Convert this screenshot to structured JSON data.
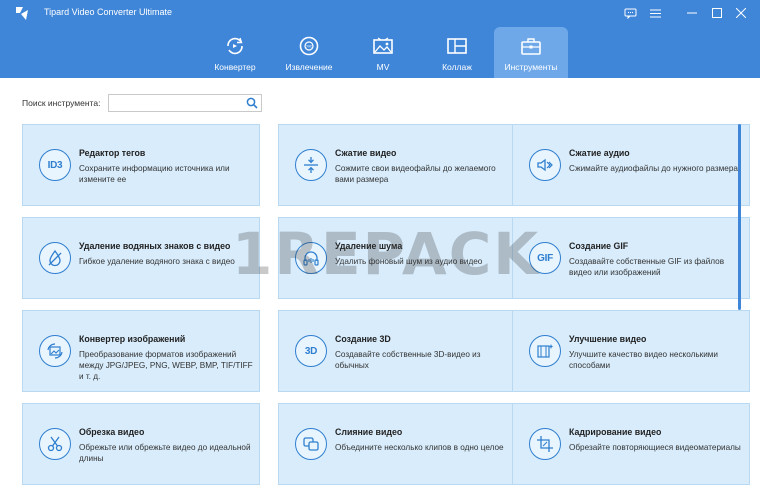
{
  "app": {
    "title": "Tipard Video Converter Ultimate"
  },
  "tabs": [
    {
      "label": "Конвертер",
      "icon": "converter-icon"
    },
    {
      "label": "Извлечение",
      "icon": "dvd-rip-icon"
    },
    {
      "label": "MV",
      "icon": "mv-image-icon"
    },
    {
      "label": "Коллаж",
      "icon": "collage-icon"
    },
    {
      "label": "Инструменты",
      "icon": "toolbox-icon",
      "active": true
    }
  ],
  "search": {
    "label": "Поиск инструмента:",
    "value": "",
    "placeholder": ""
  },
  "tools": [
    {
      "title": "Редактор тегов",
      "desc": "Сохраните информацию источника или измените ее",
      "icon_text": "ID3"
    },
    {
      "title": "Сжатие видео",
      "desc": "Сожмите свои видеофайлы до желаемого вами размера",
      "icon_text": ""
    },
    {
      "title": "Сжатие аудио",
      "desc": "Сжимайте аудиофайлы до нужного размера.",
      "icon_text": ""
    },
    {
      "title": "Удаление водяных знаков с видео",
      "desc": "Гибкое удаление водяного знака с видео",
      "icon_text": ""
    },
    {
      "title": "Удаление шума",
      "desc": "Удалить фоновый шум из аудио видео",
      "icon_text": ""
    },
    {
      "title": "Создание GIF",
      "desc": "Создавайте собственные GIF из файлов видео или изображений",
      "icon_text": "GIF"
    },
    {
      "title": "Конвертер изображений",
      "desc": "Преобразование форматов изображений между JPG/JPEG, PNG, WEBP, BMP, TIF/TIFF и т. д.",
      "icon_text": ""
    },
    {
      "title": "Создание 3D",
      "desc": "Создавайте собственные 3D-видео из обычных",
      "icon_text": "3D"
    },
    {
      "title": "Улучшение видео",
      "desc": "Улучшите качество видео несколькими способами",
      "icon_text": ""
    },
    {
      "title": "Обрезка видео",
      "desc": "Обрежьте или обрежьте видео до идеальной длины",
      "icon_text": ""
    },
    {
      "title": "Слияние видео",
      "desc": "Объедините несколько клипов в одно целое",
      "icon_text": ""
    },
    {
      "title": "Кадрирование видео",
      "desc": "Обрезайте повторяющиеся видеоматериалы",
      "icon_text": ""
    }
  ],
  "watermark": "1REPACK",
  "colors": {
    "header": "#3f86d8",
    "active_tab": "#6ea8e8",
    "card_bg": "#d8ecfb",
    "accent": "#2f7fcf"
  }
}
